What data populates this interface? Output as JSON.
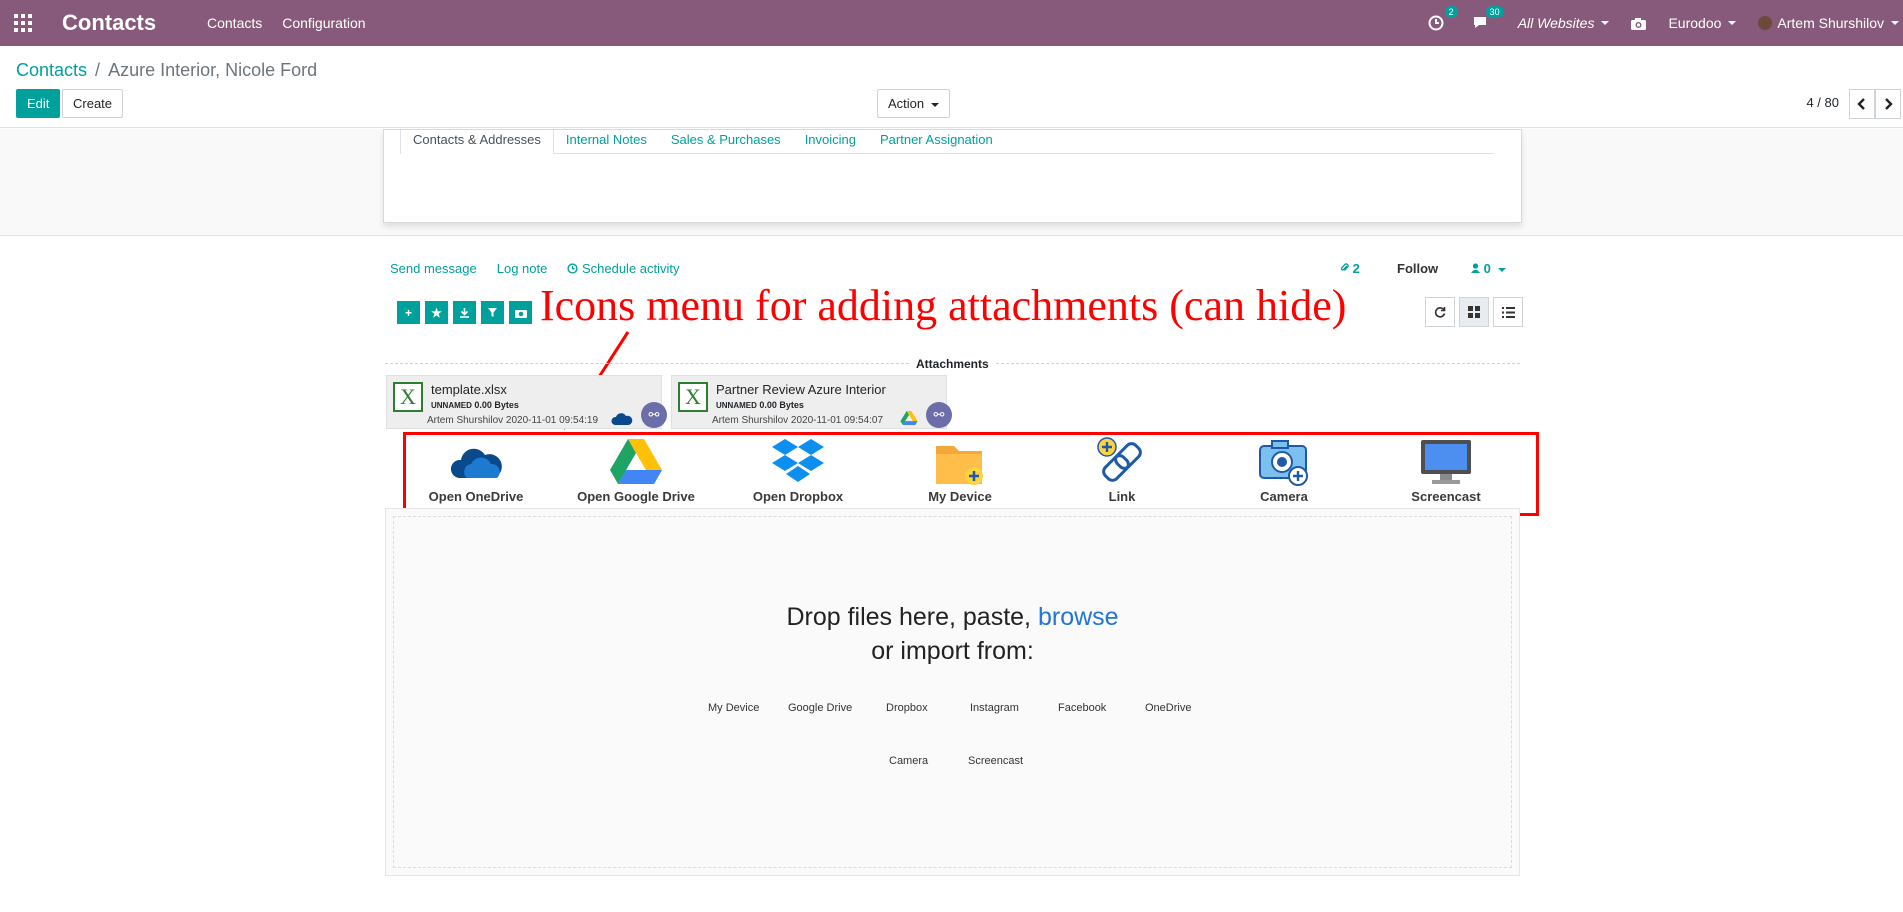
{
  "navbar": {
    "brand": "Contacts",
    "menu": [
      "Contacts",
      "Configuration"
    ],
    "activity_count": "2",
    "messages_count": "30",
    "websites": "All Websites",
    "company": "Eurodoo",
    "user": "Artem Shurshilov"
  },
  "breadcrumb": {
    "parent": "Contacts",
    "separator": "/",
    "current": "Azure Interior, Nicole Ford"
  },
  "buttons": {
    "edit": "Edit",
    "create": "Create",
    "action": "Action"
  },
  "pager": {
    "value": "4 / 80"
  },
  "tabs": [
    "Contacts & Addresses",
    "Internal Notes",
    "Sales & Purchases",
    "Invoicing",
    "Partner Assignation"
  ],
  "chatter": {
    "send_message": "Send message",
    "log_note": "Log note",
    "schedule_activity": "Schedule activity",
    "attachment_count": "2",
    "follow": "Follow",
    "followers_count": "0"
  },
  "annotation": "Icons menu for adding attachments (can hide)",
  "attachments": {
    "label": "Attachments",
    "items": [
      {
        "name": "template.xlsx",
        "tag": "UNNAMED",
        "size": "0.00 Bytes",
        "by": "Artem Shurshilov 2020-11-01 09:54:19"
      },
      {
        "name": "Partner Review Azure Interior",
        "tag": "UNNAMED",
        "size": "0.00 Bytes",
        "by": "Artem Shurshilov 2020-11-01 09:54:07"
      }
    ]
  },
  "icons_menu": [
    {
      "label": "Open OneDrive",
      "icon": "onedrive-icon"
    },
    {
      "label": "Open Google Drive",
      "icon": "google-drive-icon"
    },
    {
      "label": "Open Dropbox",
      "icon": "dropbox-icon"
    },
    {
      "label": "My Device",
      "icon": "folder-add-icon"
    },
    {
      "label": "Link",
      "icon": "link-add-icon"
    },
    {
      "label": "Camera",
      "icon": "camera-icon"
    },
    {
      "label": "Screencast",
      "icon": "monitor-icon"
    }
  ],
  "dropzone": {
    "line1_prefix": "Drop files here, paste,",
    "browse": "browse",
    "line2": "or import from:",
    "sources_row1": [
      "My Device",
      "Google Drive",
      "Dropbox",
      "Instagram",
      "Facebook",
      "OneDrive"
    ],
    "sources_row2": [
      "Camera",
      "Screencast"
    ]
  },
  "colors": {
    "navbar": "#875a7b",
    "primary": "#00a09d",
    "annotation": "#ff0000",
    "browse": "#2275d7"
  }
}
